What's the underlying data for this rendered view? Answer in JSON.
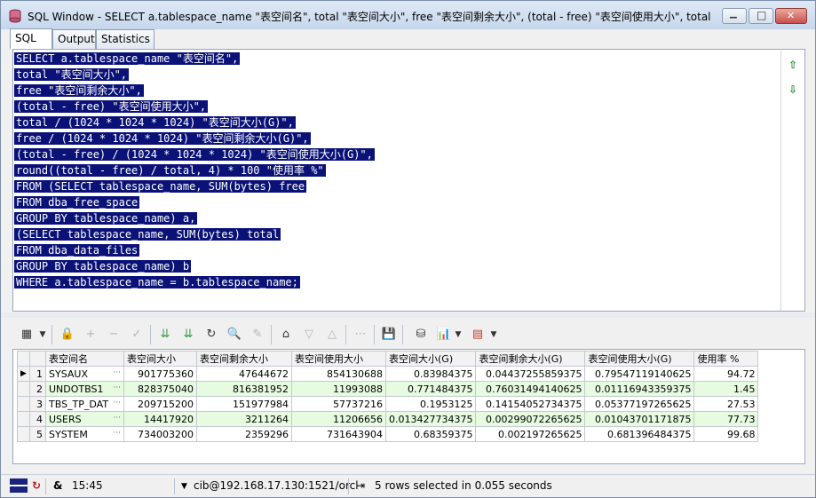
{
  "window": {
    "title": "SQL Window - SELECT a.tablespace_name \"表空间名\", total \"表空间大小\", free \"表空间剩余大小\", (total - free) \"表空间使用大小\", total",
    "minimize_glyph": "▁",
    "maximize_glyph": "□",
    "close_glyph": "✕"
  },
  "tabs": [
    {
      "label": "SQL",
      "active": true
    },
    {
      "label": "Output",
      "active": false
    },
    {
      "label": "Statistics",
      "active": false
    }
  ],
  "editor": {
    "lines": [
      "SELECT a.tablespace_name \"表空间名\",",
      "total \"表空间大小\",",
      "free \"表空间剩余大小\",",
      "(total - free) \"表空间使用大小\",",
      "total / (1024 * 1024 * 1024) \"表空间大小(G)\",",
      "free / (1024 * 1024 * 1024) \"表空间剩余大小(G)\",",
      "(total - free) / (1024 * 1024 * 1024) \"表空间使用大小(G)\",",
      "round((total - free) / total, 4) * 100 \"使用率 %\"",
      "FROM (SELECT tablespace_name, SUM(bytes) free",
      "FROM dba_free_space",
      "GROUP BY tablespace_name) a,",
      "(SELECT tablespace_name, SUM(bytes) total",
      "FROM dba_data_files",
      "GROUP BY tablespace_name) b",
      "WHERE a.tablespace_name = b.tablespace_name;"
    ],
    "selection_color": "#0a1278"
  },
  "grid": {
    "columns": [
      "表空间名",
      "表空间大小",
      "表空间剩余大小",
      "表空间使用大小",
      "表空间大小(G)",
      "表空间剩余大小(G)",
      "表空间使用大小(G)",
      "使用率 %"
    ],
    "rows": [
      [
        "1",
        "SYSAUX",
        "901775360",
        "47644672",
        "854130688",
        "0.83984375",
        "0.04437255859375",
        "0.79547119140625",
        "94.72"
      ],
      [
        "2",
        "UNDOTBS1",
        "828375040",
        "816381952",
        "11993088",
        "0.771484375",
        "0.76031494140625",
        "0.01116943359375",
        "1.45"
      ],
      [
        "3",
        "TBS_TP_DAT",
        "209715200",
        "151977984",
        "57737216",
        "0.1953125",
        "0.14154052734375",
        "0.05377197265625",
        "27.53"
      ],
      [
        "4",
        "USERS",
        "14417920",
        "3211264",
        "11206656",
        "0.013427734375",
        "0.00299072265625",
        "0.01043701171875",
        "77.73"
      ],
      [
        "5",
        "SYSTEM",
        "734003200",
        "2359296",
        "731643904",
        "0.68359375",
        "0.002197265625",
        "0.681396484375",
        "99.68"
      ]
    ],
    "alt_row_color": "#e6fbe0",
    "cell_button_glyph": "···",
    "current_row_glyph": "▶"
  },
  "status": {
    "time": "15:45",
    "ampersand": "&",
    "connection": "cib@192.168.17.130:1521/orcl",
    "message": "5 rows selected in 0.055 seconds"
  }
}
